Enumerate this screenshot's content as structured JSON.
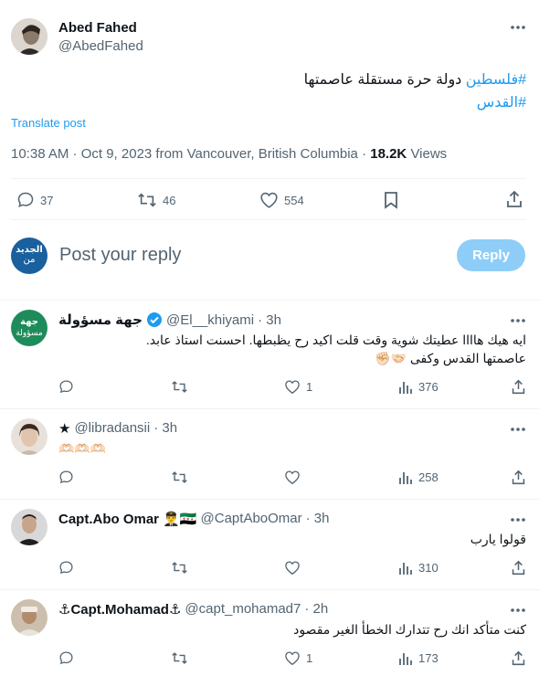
{
  "colors": {
    "accent": "#1d9bf0",
    "text": "#0f1419",
    "muted": "#536471",
    "divider": "#eff3f4"
  },
  "main_post": {
    "author_name": "Abed Fahed",
    "handle": "@AbedFahed",
    "more_icon": "more-icon",
    "text_line1_hashtag": "#فلسطين",
    "text_line1_rest": "دولة حرة مستقلة عاصمتها",
    "text_line2_hashtag": "#القدس",
    "translate": "Translate post",
    "meta_time": "10:38 AM · Oct 9, 2023 from Vancouver, British Columbia · ",
    "views_count": "18.2K",
    "views_label": "Views",
    "replies": "37",
    "reposts": "46",
    "likes": "554"
  },
  "composer": {
    "avatar_text_top": "الجديد",
    "avatar_text_bottom": "من",
    "placeholder": "Post your reply",
    "reply_button": "Reply"
  },
  "replies": [
    {
      "name": "جهة مسؤولة",
      "verified": true,
      "handle": "@El__khiyami",
      "time": "· 3h",
      "avatar_text_top": "جهة",
      "avatar_text_bottom": "مسؤولة",
      "line1": "ايه هيك هاااا عطيتك شوية وقت قلت اكيد رح يظبطها. احسنت استاذ عابد.",
      "line2": "عاصمتها القدس وكفى 🤝🏻✊🏻",
      "replies": "",
      "reposts": "",
      "likes": "1",
      "views": "376"
    },
    {
      "name": "★",
      "handle": "@libradansii",
      "time": "· 3h",
      "line1": "🫶🏻🫶🏻🫶🏻",
      "replies": "",
      "reposts": "",
      "likes": "",
      "views": "258"
    },
    {
      "name": "Capt.Abo Omar 👨‍✈️🇸🇾",
      "handle": "@CaptAboOmar",
      "time": "· 3h",
      "line1": "قولوا يارب",
      "replies": "",
      "reposts": "",
      "likes": "",
      "views": "310"
    },
    {
      "name": "⚓Capt.Mohamad⚓",
      "handle": "@capt_mohamad7",
      "time": "· 2h",
      "line1": "كنت متأكد انك رح تتدارك الخطأ الغير مقصود",
      "replies": "",
      "reposts": "",
      "likes": "1",
      "views": "173"
    }
  ]
}
